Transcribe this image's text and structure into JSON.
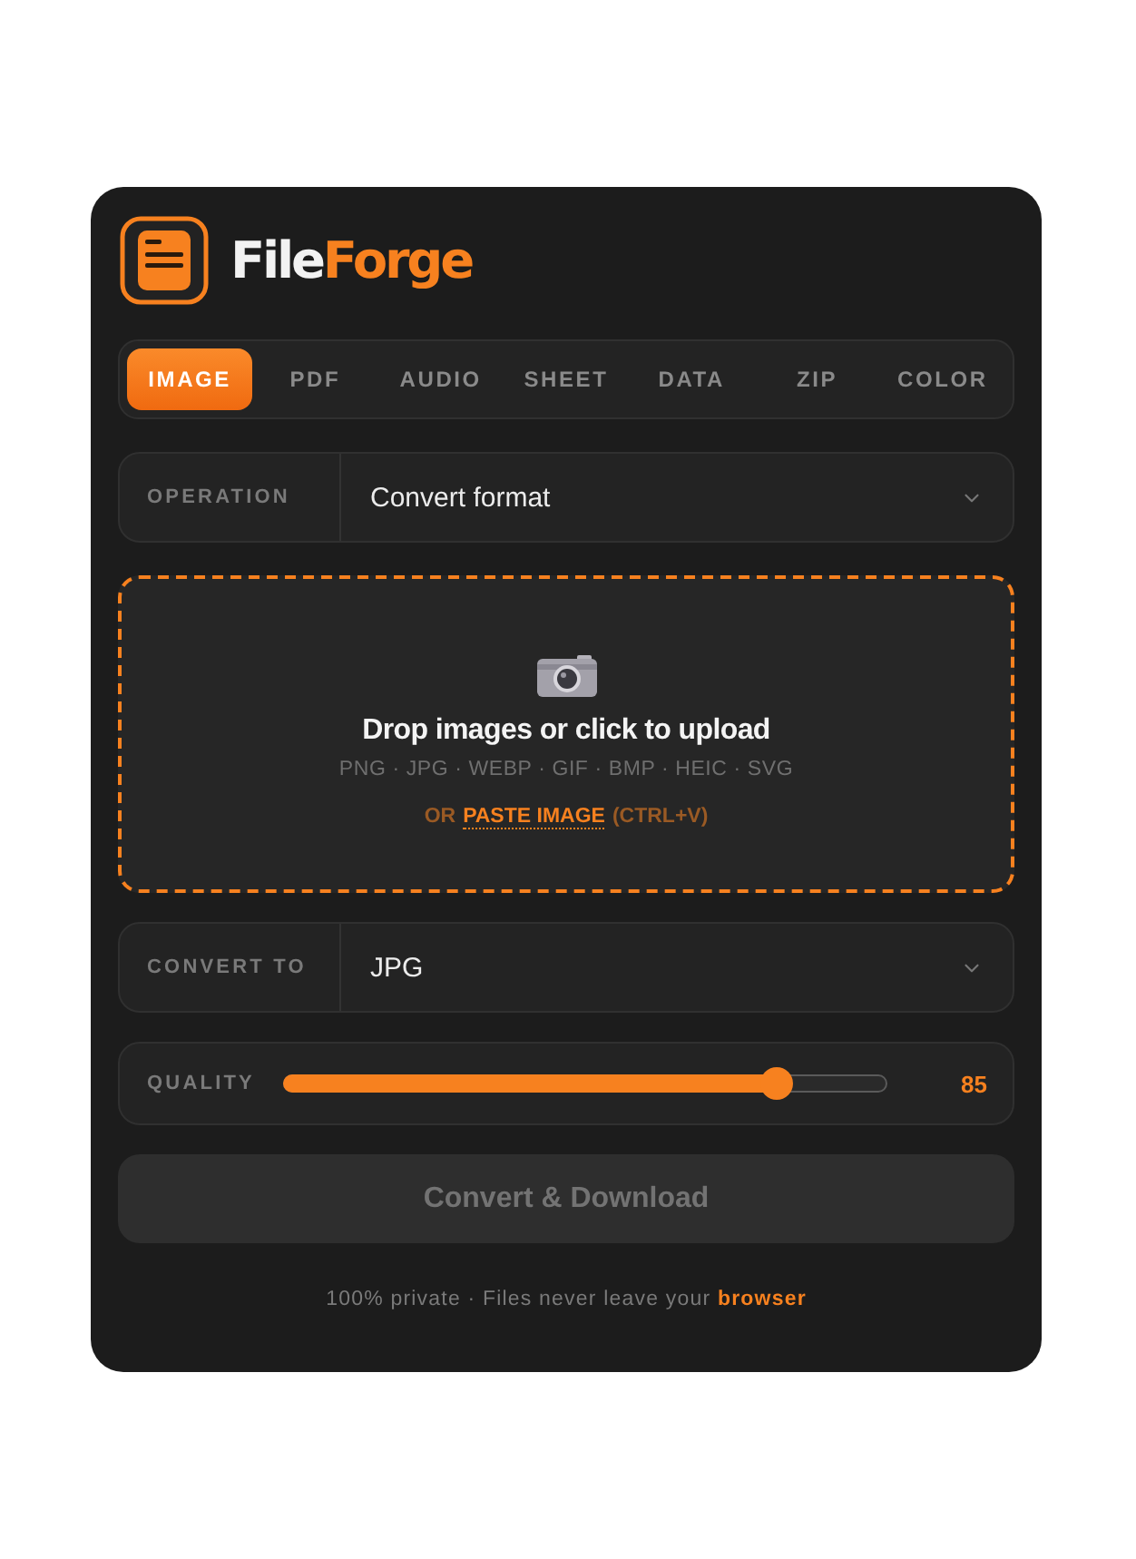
{
  "brand": {
    "name_start": "File",
    "name_end": "Forge"
  },
  "tabs": [
    {
      "label": "IMAGE",
      "selected": true
    },
    {
      "label": "PDF",
      "selected": false
    },
    {
      "label": "AUDIO",
      "selected": false
    },
    {
      "label": "SHEET",
      "selected": false
    },
    {
      "label": "DATA",
      "selected": false
    },
    {
      "label": "ZIP",
      "selected": false
    },
    {
      "label": "COLOR",
      "selected": false
    }
  ],
  "operation": {
    "label": "OPERATION",
    "value": "Convert format"
  },
  "dropzone": {
    "title": "Drop images or click to upload",
    "formats": "PNG · JPG · WEBP · GIF · BMP · HEIC · SVG",
    "paste_prefix": "OR",
    "paste_link": "PASTE IMAGE",
    "paste_shortcut": "(CTRL+V)"
  },
  "convert_to": {
    "label": "CONVERT TO",
    "value": "JPG"
  },
  "quality": {
    "label": "QUALITY",
    "level": 0.82,
    "reading": "85"
  },
  "action_button": {
    "label": "Convert & Download",
    "disabled": true
  },
  "footer": {
    "note": "100% private · Files never leave your **browser**"
  }
}
